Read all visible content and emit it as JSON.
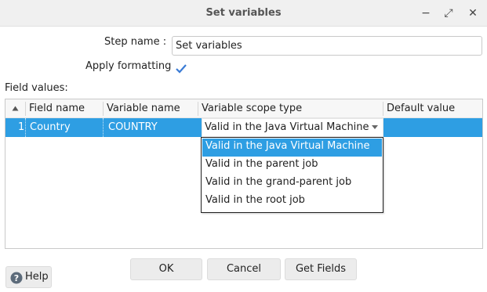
{
  "window": {
    "title": "Set variables",
    "minimize_glyph": "−",
    "maximize_glyph": "⤢",
    "close_glyph": "✕"
  },
  "form": {
    "step_name_label": "Step name :",
    "step_name_value": "Set variables",
    "apply_formatting_label": "Apply formatting",
    "apply_formatting_checked": true,
    "field_values_label": "Field values:"
  },
  "table": {
    "columns": [
      "Field name",
      "Variable name",
      "Variable scope type",
      "Default value"
    ],
    "rows": [
      {
        "num": "1",
        "field_name": "Country",
        "variable_name": "COUNTRY",
        "scope": "Valid in the Java Virtual Machine",
        "default_value": ""
      }
    ]
  },
  "dropdown": {
    "options": [
      "Valid in the Java Virtual Machine",
      "Valid in the parent job",
      "Valid in the grand-parent job",
      "Valid in the root job"
    ],
    "selected_index": 0
  },
  "buttons": {
    "ok": "OK",
    "cancel": "Cancel",
    "get_fields": "Get Fields",
    "help": "Help"
  },
  "colors": {
    "selection": "#2e9ee3",
    "check": "#3a7bd5"
  },
  "icons": {
    "help": "help-icon",
    "checkbox": "check-icon",
    "sort": "sort-up-icon"
  }
}
